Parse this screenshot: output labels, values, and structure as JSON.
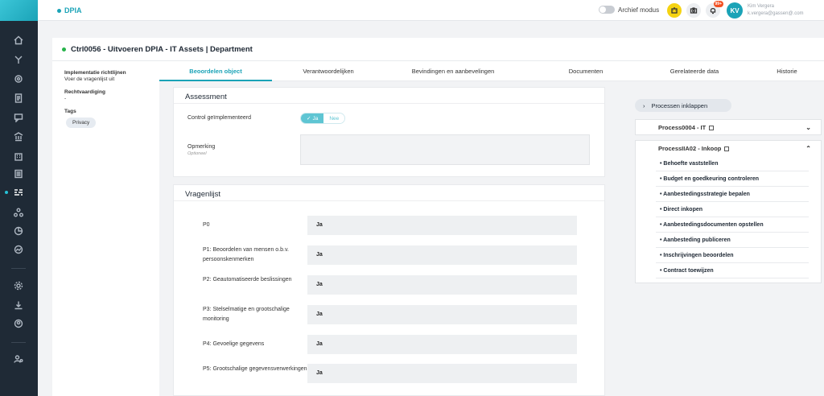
{
  "app": {
    "name": "DPIA"
  },
  "header": {
    "archive_label": "Archief modus",
    "notification_count": "99+",
    "avatar_initials": "KV",
    "user_name": "Kim Vergera",
    "user_email": "k.vergera@gassen@.com"
  },
  "sidebar": {
    "items": [
      {
        "icon": "home-icon"
      },
      {
        "icon": "branch-icon"
      },
      {
        "icon": "gear-outline-icon"
      },
      {
        "icon": "document-icon"
      },
      {
        "icon": "chat-icon"
      },
      {
        "icon": "bank-icon"
      },
      {
        "icon": "building-icon"
      },
      {
        "icon": "list-icon"
      },
      {
        "icon": "dpia-icon",
        "active": true
      },
      {
        "icon": "network-icon"
      },
      {
        "icon": "pie-icon"
      },
      {
        "icon": "trend-icon"
      },
      {
        "icon": "settings-icon"
      },
      {
        "icon": "download-icon"
      },
      {
        "icon": "user-icon"
      },
      {
        "icon": "users-settings-icon"
      }
    ]
  },
  "page": {
    "title": "Ctrl0056 - Uitvoeren DPIA - IT Assets | Department",
    "status_color": "#27b34a"
  },
  "meta": {
    "impl_label": "Implementatie richtlijnen",
    "impl_value": "Voer de vragenlijst uit",
    "legal_label": "Rechtvaardiging",
    "legal_value": "-",
    "tags_label": "Tags",
    "tags": [
      "Privacy"
    ]
  },
  "tabs": [
    "Beoordelen object",
    "Verantwoordelijken",
    "Bevindingen en aanbevelingen",
    "Documenten",
    "Gerelateerde data",
    "Historie"
  ],
  "assessment": {
    "title": "Assessment",
    "control_label": "Control geïmplementeerd",
    "yes": "Ja",
    "no": "Nee",
    "remark_label": "Opmerking",
    "remark_optional": "Optioneel"
  },
  "vragenlijst": {
    "title": "Vragenlijst",
    "questions": [
      {
        "label": "P0",
        "answer": "Ja"
      },
      {
        "label": "P1: Beoordelen van mensen o.b.v. persoonskenmerken",
        "answer": "Ja"
      },
      {
        "label": "P2: Geautomatiseerde beslissingen",
        "answer": "Ja"
      },
      {
        "label": "P3: Stelselmatige en grootschalige monitoring",
        "answer": "Ja"
      },
      {
        "label": "P4: Gevoelige gegevens",
        "answer": "Ja"
      },
      {
        "label": "P5: Grootschalige gegevensverwerkingen",
        "answer": "Ja"
      }
    ]
  },
  "processes": {
    "collapse_label": "Processen inklappen",
    "p1": {
      "name": "Process0004 - IT"
    },
    "p2": {
      "name": "ProcessIIA02 - Inkoop",
      "items": [
        "• Behoefte vaststellen",
        "• Budget en goedkeuring controleren",
        "• Aanbestedingsstrategie bepalen",
        "• Direct inkopen",
        "• Aanbestedingsdocumenten opstellen",
        "• Aanbesteding publiceren",
        "• Inschrijvingen beoordelen",
        "• Contract toewijzen"
      ]
    }
  }
}
